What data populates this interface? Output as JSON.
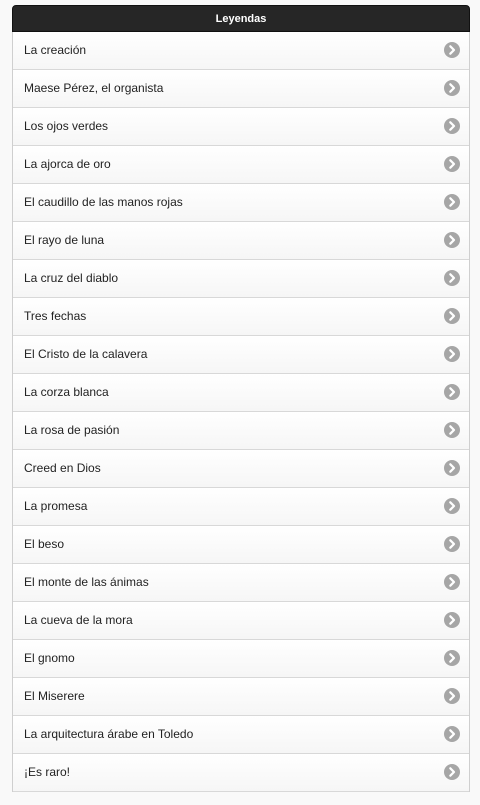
{
  "header": {
    "title": "Leyendas"
  },
  "colors": {
    "header_bg": "#262626",
    "chevron": "#a6a6a6"
  },
  "list": {
    "items": [
      {
        "label": "La creación"
      },
      {
        "label": "Maese Pérez, el organista"
      },
      {
        "label": "Los ojos verdes"
      },
      {
        "label": "La ajorca de oro"
      },
      {
        "label": "El caudillo de las manos rojas"
      },
      {
        "label": "El rayo de luna"
      },
      {
        "label": "La cruz del diablo"
      },
      {
        "label": "Tres fechas"
      },
      {
        "label": "El Cristo de la calavera"
      },
      {
        "label": "La corza blanca"
      },
      {
        "label": "La rosa de pasión"
      },
      {
        "label": "Creed en Dios"
      },
      {
        "label": "La promesa"
      },
      {
        "label": "El beso"
      },
      {
        "label": "El monte de las ánimas"
      },
      {
        "label": "La cueva de la mora"
      },
      {
        "label": "El gnomo"
      },
      {
        "label": "El Miserere"
      },
      {
        "label": "La arquitectura árabe en Toledo"
      },
      {
        "label": "¡Es raro!"
      }
    ],
    "item_icon": "chevron-right-icon"
  }
}
